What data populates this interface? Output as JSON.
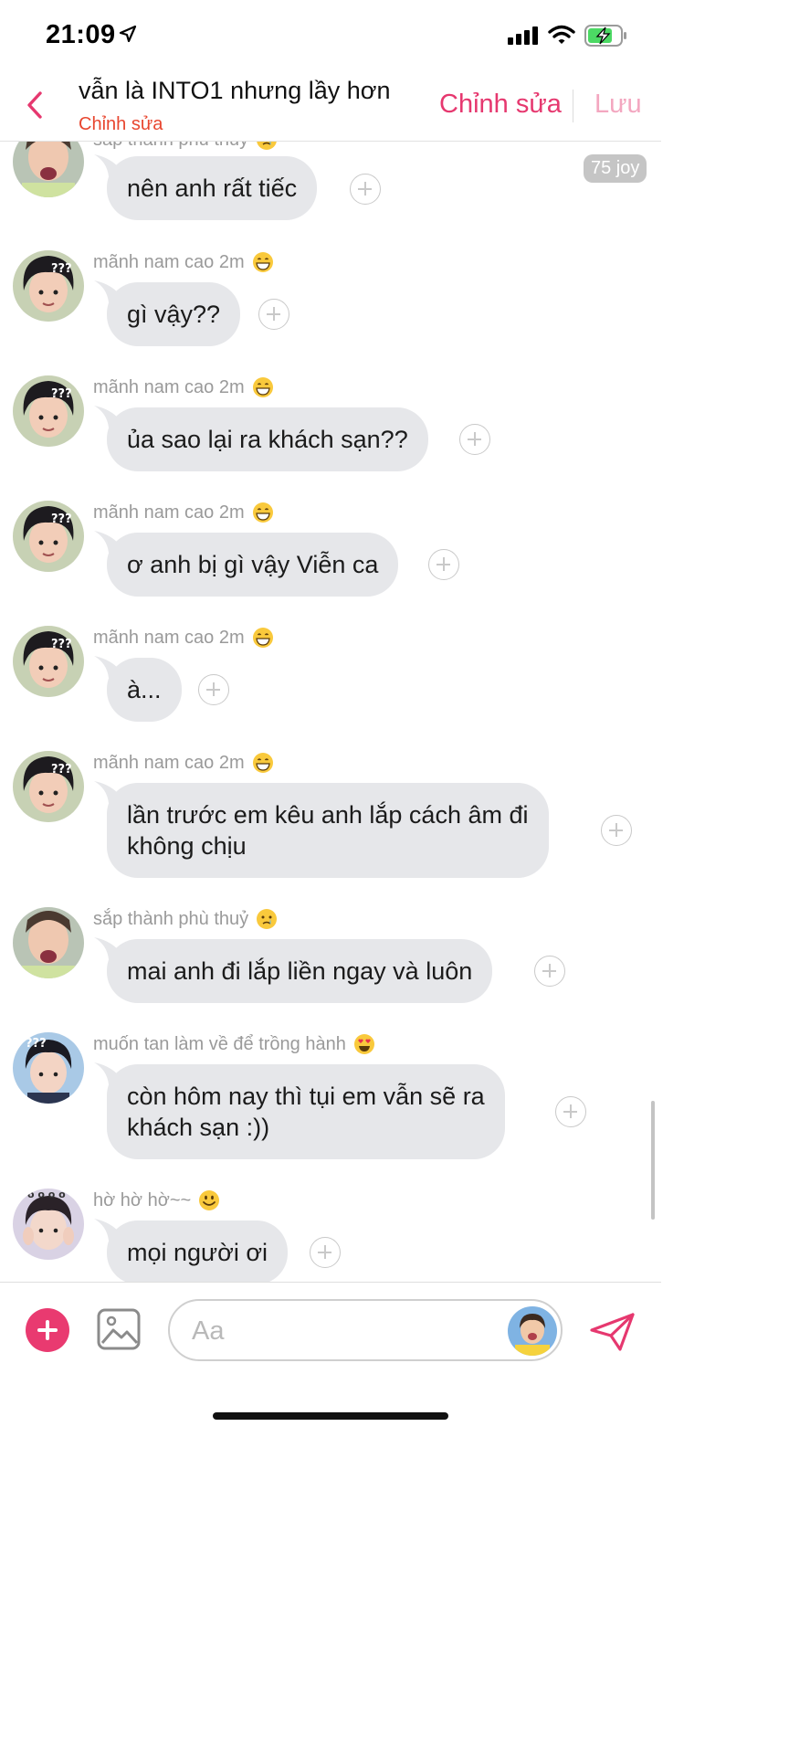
{
  "status_bar": {
    "time": "21:09",
    "icons": [
      "location-arrow-icon",
      "cellular-signal-icon",
      "wifi-icon",
      "battery-charging-icon"
    ]
  },
  "header": {
    "title": "vẫn là INTO1 nhưng lầy hơn",
    "subtitle": "Chỉnh sửa",
    "edit_label": "Chỉnh sửa",
    "save_label": "Lưu"
  },
  "colors": {
    "accent": "#e6386f",
    "subtitle": "#e8462f",
    "bubble": "#e6e7ea",
    "save_disabled": "#f3a7c0"
  },
  "joy_badge": "75 joy",
  "messages": [
    {
      "sender": "sắp thành phù thuỷ",
      "emoji": "crying-face",
      "text_lines": [
        "nên anh rất tiếc"
      ]
    },
    {
      "sender": "mãnh nam cao 2m",
      "emoji": "grinning-face",
      "text_lines": [
        "gì vậy??"
      ]
    },
    {
      "sender": "mãnh nam cao 2m",
      "emoji": "grinning-face",
      "text_lines": [
        "ủa sao lại ra khách sạn??"
      ]
    },
    {
      "sender": "mãnh nam cao 2m",
      "emoji": "grinning-face",
      "text_lines": [
        "ơ anh bị gì vậy Viễn ca"
      ]
    },
    {
      "sender": "mãnh nam cao 2m",
      "emoji": "grinning-face",
      "text_lines": [
        "à..."
      ]
    },
    {
      "sender": "mãnh nam cao 2m",
      "emoji": "grinning-face",
      "text_lines": [
        "lần trước em kêu anh lắp cách âm đi",
        "không chịu"
      ]
    },
    {
      "sender": "sắp thành phù thuỷ",
      "emoji": "crying-face",
      "text_lines": [
        "mai anh đi lắp liền ngay và luôn"
      ]
    },
    {
      "sender": "muốn tan làm về để trồng hành",
      "emoji": "heart-eyes-face",
      "text_lines": [
        "còn hôm nay thì tụi em vẫn sẽ ra",
        "khách sạn :))"
      ]
    },
    {
      "sender": "hờ hờ hờ~~",
      "emoji": "smiling-face",
      "text_lines": [
        "mọi người ơi"
      ]
    }
  ],
  "composer": {
    "placeholder": "Aa"
  }
}
